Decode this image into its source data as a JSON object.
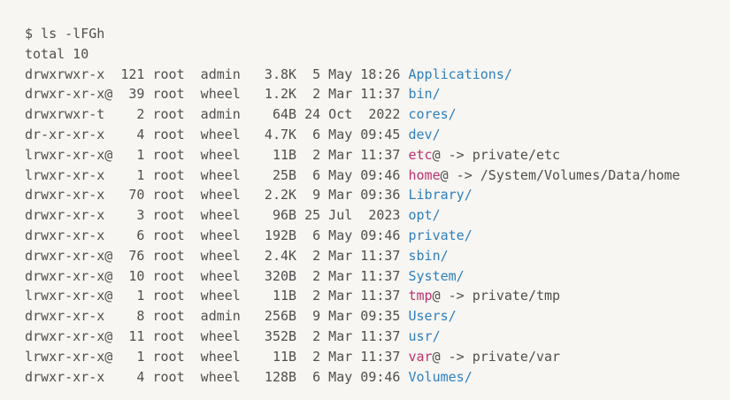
{
  "terminal": {
    "prompt_line": "$ ls -lFGh",
    "total_line": "total 10",
    "colors": {
      "background": "#f7f6f2",
      "text": "#4f4f4f",
      "directory": "#2f7fbf",
      "symlink": "#c0306e"
    },
    "entries": [
      {
        "meta": "drwxrwxr-x  121 root  admin   3.8K  5 May 18:26 ",
        "name": "Applications",
        "suffix": "/",
        "type": "dir",
        "target": ""
      },
      {
        "meta": "drwxr-xr-x@  39 root  wheel   1.2K  2 Mar 11:37 ",
        "name": "bin",
        "suffix": "/",
        "type": "dir",
        "target": ""
      },
      {
        "meta": "drwxrwxr-t    2 root  admin    64B 24 Oct  2022 ",
        "name": "cores",
        "suffix": "/",
        "type": "dir",
        "target": ""
      },
      {
        "meta": "dr-xr-xr-x    4 root  wheel   4.7K  6 May 09:45 ",
        "name": "dev",
        "suffix": "/",
        "type": "dir",
        "target": ""
      },
      {
        "meta": "lrwxr-xr-x@   1 root  wheel    11B  2 Mar 11:37 ",
        "name": "etc",
        "suffix": "@",
        "type": "link",
        "target": " -> private/etc"
      },
      {
        "meta": "lrwxr-xr-x    1 root  wheel    25B  6 May 09:46 ",
        "name": "home",
        "suffix": "@",
        "type": "link",
        "target": " -> /System/Volumes/Data/home"
      },
      {
        "meta": "drwxr-xr-x   70 root  wheel   2.2K  9 Mar 09:36 ",
        "name": "Library",
        "suffix": "/",
        "type": "dir",
        "target": ""
      },
      {
        "meta": "drwxr-xr-x    3 root  wheel    96B 25 Jul  2023 ",
        "name": "opt",
        "suffix": "/",
        "type": "dir",
        "target": ""
      },
      {
        "meta": "drwxr-xr-x    6 root  wheel   192B  6 May 09:46 ",
        "name": "private",
        "suffix": "/",
        "type": "dir",
        "target": ""
      },
      {
        "meta": "drwxr-xr-x@  76 root  wheel   2.4K  2 Mar 11:37 ",
        "name": "sbin",
        "suffix": "/",
        "type": "dir",
        "target": ""
      },
      {
        "meta": "drwxr-xr-x@  10 root  wheel   320B  2 Mar 11:37 ",
        "name": "System",
        "suffix": "/",
        "type": "dir",
        "target": ""
      },
      {
        "meta": "lrwxr-xr-x@   1 root  wheel    11B  2 Mar 11:37 ",
        "name": "tmp",
        "suffix": "@",
        "type": "link",
        "target": " -> private/tmp"
      },
      {
        "meta": "drwxr-xr-x    8 root  admin   256B  9 Mar 09:35 ",
        "name": "Users",
        "suffix": "/",
        "type": "dir",
        "target": ""
      },
      {
        "meta": "drwxr-xr-x@  11 root  wheel   352B  2 Mar 11:37 ",
        "name": "usr",
        "suffix": "/",
        "type": "dir",
        "target": ""
      },
      {
        "meta": "lrwxr-xr-x@   1 root  wheel    11B  2 Mar 11:37 ",
        "name": "var",
        "suffix": "@",
        "type": "link",
        "target": " -> private/var"
      },
      {
        "meta": "drwxr-xr-x    4 root  wheel   128B  6 May 09:46 ",
        "name": "Volumes",
        "suffix": "/",
        "type": "dir",
        "target": ""
      }
    ]
  }
}
